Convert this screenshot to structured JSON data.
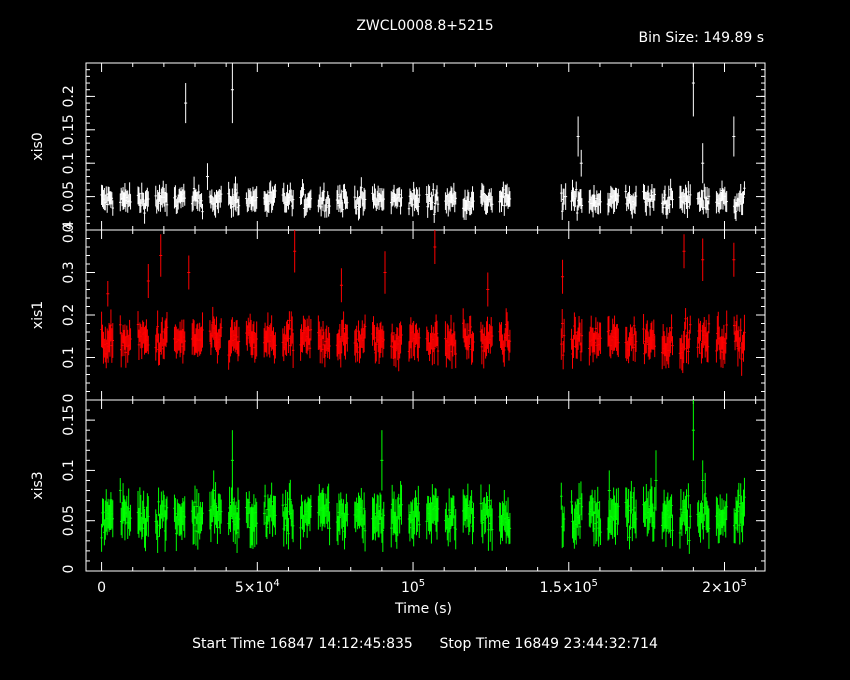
{
  "title": "ZWCL0008.8+5215",
  "bin_size_text": "Bin Size: 149.89 s",
  "footer": {
    "start_label": "Start Time",
    "start_value": "16847 14:12:45:835",
    "stop_label": "Stop Time",
    "stop_value": "16849 23:44:32:714"
  },
  "chart_data": {
    "type": "scatter",
    "xlabel": "Time (s)",
    "xlim": [
      -5000,
      213000
    ],
    "x_ticks": [
      {
        "value": 0,
        "label": "0"
      },
      {
        "value": 50000,
        "label": "5×10^4"
      },
      {
        "value": 100000,
        "label": "10^5"
      },
      {
        "value": 150000,
        "label": "1.5×10^5"
      },
      {
        "value": 200000,
        "label": "2×10^5"
      }
    ],
    "data_gaps": [
      [
        132000,
        147500
      ]
    ],
    "panels": [
      {
        "name": "xis0",
        "ylabel": "xis0",
        "color": "#ffffff",
        "ylim": [
          0,
          0.25
        ],
        "y_ticks": [
          {
            "value": 0,
            "label": "0"
          },
          {
            "value": 0.05,
            "label": "0.05"
          },
          {
            "value": 0.1,
            "label": "0.1"
          },
          {
            "value": 0.15,
            "label": "0.15"
          },
          {
            "value": 0.2,
            "label": "0.2"
          }
        ],
        "typical_rate": 0.045,
        "typical_error": 0.015,
        "points": [
          {
            "x": 27000,
            "y": 0.19,
            "err": 0.03
          },
          {
            "x": 34000,
            "y": 0.08,
            "err": 0.02
          },
          {
            "x": 42000,
            "y": 0.21,
            "err": 0.05
          },
          {
            "x": 43000,
            "y": 0.06,
            "err": 0.02
          },
          {
            "x": 149000,
            "y": 0.05,
            "err": 0.02
          },
          {
            "x": 153000,
            "y": 0.14,
            "err": 0.03
          },
          {
            "x": 154000,
            "y": 0.1,
            "err": 0.02
          },
          {
            "x": 190000,
            "y": 0.22,
            "err": 0.05
          },
          {
            "x": 193000,
            "y": 0.1,
            "err": 0.03
          },
          {
            "x": 203000,
            "y": 0.14,
            "err": 0.03
          }
        ]
      },
      {
        "name": "xis1",
        "ylabel": "xis1",
        "color": "#ff0000",
        "ylim": [
          0,
          0.4
        ],
        "y_ticks": [
          {
            "value": 0,
            "label": "0"
          },
          {
            "value": 0.1,
            "label": "0.1"
          },
          {
            "value": 0.2,
            "label": "0.2"
          },
          {
            "value": 0.3,
            "label": "0.3"
          },
          {
            "value": 0.4,
            "label": "0.4"
          }
        ],
        "typical_rate": 0.14,
        "typical_error": 0.035,
        "points": [
          {
            "x": 2000,
            "y": 0.25,
            "err": 0.03
          },
          {
            "x": 15000,
            "y": 0.28,
            "err": 0.04
          },
          {
            "x": 19000,
            "y": 0.34,
            "err": 0.05
          },
          {
            "x": 28000,
            "y": 0.3,
            "err": 0.04
          },
          {
            "x": 62000,
            "y": 0.35,
            "err": 0.05
          },
          {
            "x": 77000,
            "y": 0.27,
            "err": 0.04
          },
          {
            "x": 91000,
            "y": 0.3,
            "err": 0.05
          },
          {
            "x": 107000,
            "y": 0.36,
            "err": 0.04
          },
          {
            "x": 124000,
            "y": 0.26,
            "err": 0.04
          },
          {
            "x": 148000,
            "y": 0.29,
            "err": 0.04
          },
          {
            "x": 187000,
            "y": 0.35,
            "err": 0.04
          },
          {
            "x": 193000,
            "y": 0.33,
            "err": 0.05
          },
          {
            "x": 203000,
            "y": 0.33,
            "err": 0.04
          }
        ]
      },
      {
        "name": "xis3",
        "ylabel": "xis3",
        "color": "#00ff00",
        "ylim": [
          0,
          0.17
        ],
        "y_ticks": [
          {
            "value": 0,
            "label": "0"
          },
          {
            "value": 0.05,
            "label": "0.05"
          },
          {
            "value": 0.1,
            "label": "0.1"
          },
          {
            "value": 0.15,
            "label": "0.15"
          }
        ],
        "typical_rate": 0.055,
        "typical_error": 0.018,
        "points": [
          {
            "x": 36000,
            "y": 0.08,
            "err": 0.02
          },
          {
            "x": 42000,
            "y": 0.11,
            "err": 0.03
          },
          {
            "x": 90000,
            "y": 0.11,
            "err": 0.03
          },
          {
            "x": 163000,
            "y": 0.08,
            "err": 0.02
          },
          {
            "x": 178000,
            "y": 0.09,
            "err": 0.03
          },
          {
            "x": 190000,
            "y": 0.14,
            "err": 0.03
          },
          {
            "x": 193000,
            "y": 0.09,
            "err": 0.02
          }
        ]
      }
    ]
  }
}
